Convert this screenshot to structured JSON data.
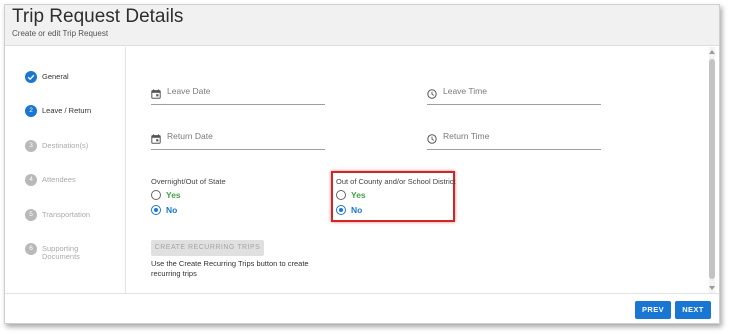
{
  "header": {
    "title": "Trip Request Details",
    "subtitle": "Create or edit Trip Request"
  },
  "steps": [
    {
      "number": "",
      "label": "General",
      "state": "done"
    },
    {
      "number": "2",
      "label": "Leave / Return",
      "state": "active"
    },
    {
      "number": "3",
      "label": "Destination(s)",
      "state": "pending"
    },
    {
      "number": "4",
      "label": "Attendees",
      "state": "pending"
    },
    {
      "number": "5",
      "label": "Transportation",
      "state": "pending"
    },
    {
      "number": "6",
      "label": "Supporting Documents",
      "state": "pending"
    }
  ],
  "fields": {
    "leave_date": {
      "placeholder": "Leave Date",
      "value": "",
      "icon": "calendar-icon"
    },
    "leave_time": {
      "placeholder": "Leave Time",
      "value": "",
      "icon": "clock-icon"
    },
    "return_date": {
      "placeholder": "Return Date",
      "value": "",
      "icon": "calendar-icon"
    },
    "return_time": {
      "placeholder": "Return Time",
      "value": "",
      "icon": "clock-icon"
    }
  },
  "overnight": {
    "label": "Overnight/Out of State",
    "yes": "Yes",
    "no": "No",
    "selected": "No"
  },
  "out_of_county": {
    "label": "Out of County and/or School District",
    "yes": "Yes",
    "no": "No",
    "selected": "No"
  },
  "recurring": {
    "button_label": "CREATE RECURRING TRIPS",
    "help": "Use the Create Recurring Trips button to create recurring trips"
  },
  "footer": {
    "prev": "PREV",
    "next": "NEXT"
  },
  "colors": {
    "primary": "#1976d2",
    "yes": "#43a047",
    "highlight": "#d12626",
    "header_bg": "#f1f1f1"
  }
}
